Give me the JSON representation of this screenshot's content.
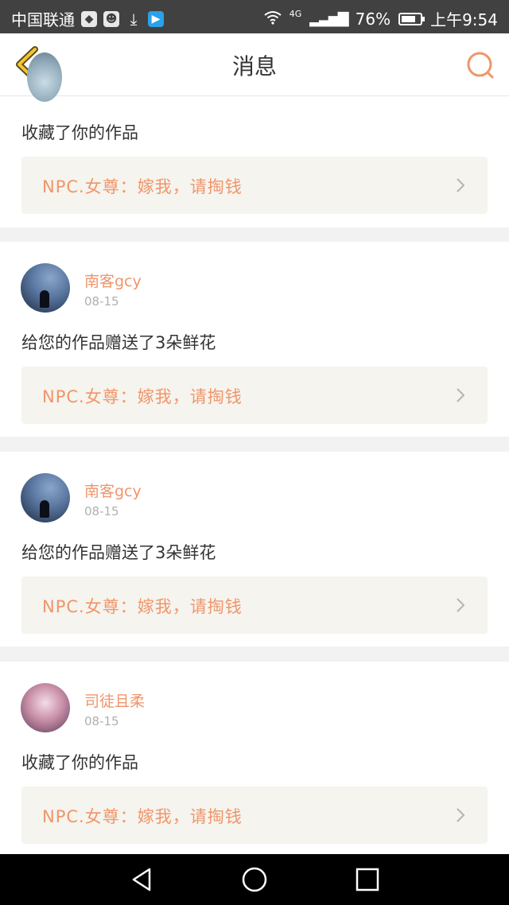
{
  "status_bar": {
    "carrier": "中国联通",
    "network": "4G",
    "battery": "76%",
    "battery_level": 0.76,
    "time": "上午9:54"
  },
  "nav": {
    "title": "消息"
  },
  "messages": [
    {
      "action": "收藏了你的作品",
      "work_title": "NPC.女尊：嫁我，请掏钱"
    },
    {
      "user": "南客gcy",
      "date": "08-15",
      "action": "给您的作品赠送了3朵鲜花",
      "work_title": "NPC.女尊：嫁我，请掏钱"
    },
    {
      "user": "南客gcy",
      "date": "08-15",
      "action": "给您的作品赠送了3朵鲜花",
      "work_title": "NPC.女尊：嫁我，请掏钱"
    },
    {
      "user": "司徒且柔",
      "date": "08-15",
      "action": "收藏了你的作品",
      "work_title": "NPC.女尊：嫁我，请掏钱"
    }
  ],
  "colors": {
    "accent": "#f0956a",
    "status_bar_bg": "#414141",
    "work_box_bg": "#f5f4ee"
  }
}
